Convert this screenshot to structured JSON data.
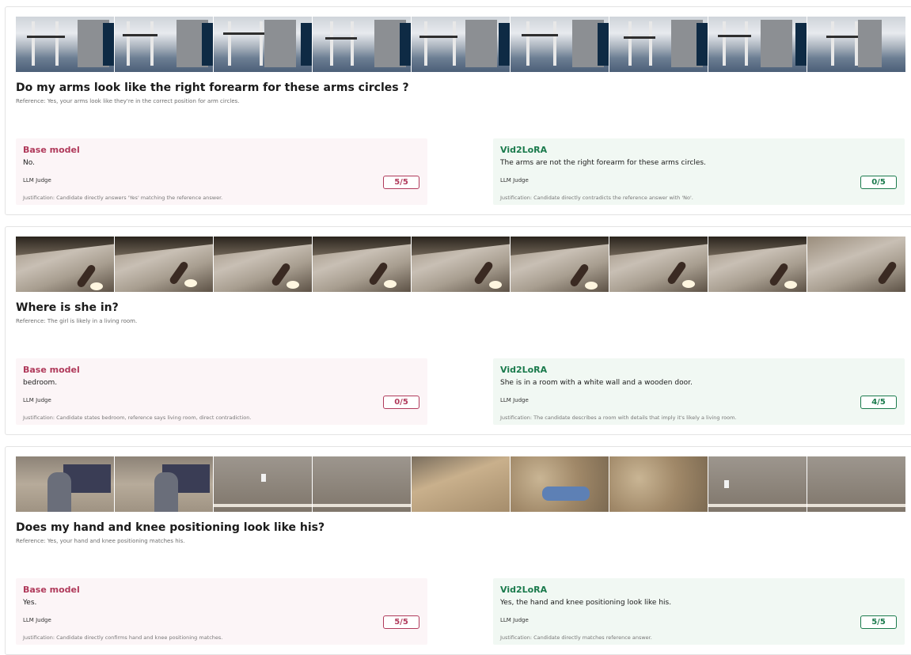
{
  "items": [
    {
      "scene": "gym",
      "question": "Do my arms look like the right forearm for these arms circles ?",
      "reference": "Reference: Yes, your arms look like they're in the correct position for arm circles.",
      "base": {
        "title": "Base model",
        "answer": "No.",
        "judge": "LLM Judge",
        "score": "5/5",
        "justification": "Justification: Candidate directly answers 'Yes' matching the reference answer."
      },
      "vid": {
        "title": "Vid2LoRA",
        "answer": "The arms are not the right forearm for these arms circles.",
        "judge": "LLM Judge",
        "score": "0/5",
        "justification": "Justification: Candidate directly contradicts the reference answer with 'No'."
      }
    },
    {
      "scene": "room",
      "question": "Where is she in?",
      "reference": "Reference: The girl is likely in a living room.",
      "base": {
        "title": "Base model",
        "answer": "bedroom.",
        "judge": "LLM Judge",
        "score": "0/5",
        "justification": "Justification: Candidate states bedroom, reference says living room, direct contradiction."
      },
      "vid": {
        "title": "Vid2LoRA",
        "answer": "She is in a room with a white wall and a wooden door.",
        "judge": "LLM Judge",
        "score": "4/5",
        "justification": "Justification: The candidate describes a room with details that imply it's likely a living room."
      }
    },
    {
      "scene": "mixed",
      "question": "Does my hand and knee positioning look like his?",
      "reference": "Reference: Yes, your hand and knee positioning matches his.",
      "base": {
        "title": "Base model",
        "answer": "Yes.",
        "judge": "LLM Judge",
        "score": "5/5",
        "justification": "Justification: Candidate directly confirms hand and knee positioning matches."
      },
      "vid": {
        "title": "Vid2LoRA",
        "answer": "Yes, the hand and knee positioning look like his.",
        "judge": "LLM Judge",
        "score": "5/5",
        "justification": "Justification: Candidate directly matches reference answer."
      }
    }
  ],
  "colors": {
    "base_accent": "#b03a5b",
    "vid_accent": "#1a7a4c",
    "base_bg": "#fcf5f7",
    "vid_bg": "#f1f8f3"
  }
}
